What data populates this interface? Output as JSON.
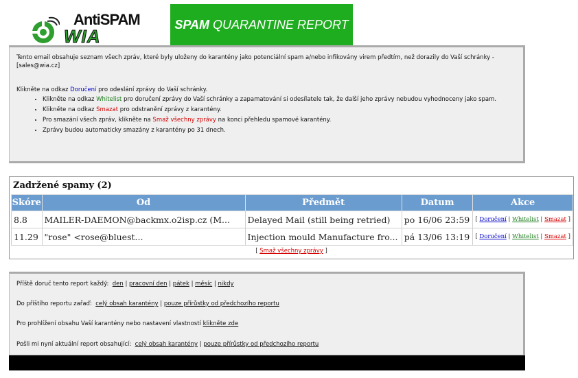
{
  "header": {
    "logo_anti": "AntiSPAM",
    "logo_wia": "WIA",
    "banner_strong": "SPAM",
    "banner_rest": "QUARANTINE REPORT"
  },
  "info": {
    "intro": "Tento email obsahuje seznam všech zpráv, které byly uloženy do karantény jako potenciální spam a/nebo infikovány virem předtím, než dorazily do Vaší schránky - [sales@wia.cz]",
    "click_pre": "Klikněte na odkaz",
    "click_link": "Doručení",
    "click_post": "pro odeslání zprávy do Vaší schránky.",
    "bullets": [
      {
        "pre": "Klikněte na odkaz",
        "link": "Whitelist",
        "post": "pro doručení zprávy do Vaší schránky a zapamatování si odesílatele tak, že další jeho zprávy nebudou vyhodnoceny jako spam."
      },
      {
        "pre": "Klikněte na odkaz",
        "link": "Smazat",
        "post": "pro odstranění zprávy z karantény."
      },
      {
        "pre": "Pro smazání všech zpráv, klikněte na",
        "link": "Smaž všechny zprávy",
        "post": "na konci přehledu spamové karantény."
      },
      {
        "pre": "Zprávy budou automaticky smazány z karantény po 31 dnech.",
        "link": "",
        "post": ""
      }
    ]
  },
  "table": {
    "title": "Zadržené spamy (2)",
    "headers": [
      "Skóre",
      "Od",
      "Předmět",
      "Datum",
      "Akce"
    ],
    "rows": [
      {
        "score": "8.8",
        "from": "MAILER-DAEMON@backmx.o2isp.cz (M...",
        "subject": "Delayed Mail (still being retried)",
        "date": "po 16/06 23:59"
      },
      {
        "score": "11.29",
        "from": "\"rose\" <rose@bluest...",
        "subject": "Injection mould Manufacture fro...",
        "date": "pá 13/06 13:19"
      }
    ],
    "actions": {
      "deliver": "Doručení",
      "whitelist": "Whitelist",
      "delete": "Smazat"
    },
    "delete_all": "Smaž všechny zprávy"
  },
  "bottom": {
    "row1_label": "Příště doruč tento report každý:",
    "row1_links": [
      "den",
      "pracovní den",
      "pátek",
      "měsíc",
      "nikdy"
    ],
    "row2_label": "Do příštího reportu zařaď:",
    "row2_links": [
      "celý obsah karantény",
      "pouze přírůstky od předchozího reportu"
    ],
    "row3_label": "Pro prohlížení obsahu Vaší karantény nebo nastavení vlastností",
    "row3_link": "klikněte zde",
    "row4_label": "Pošli mi nyní aktuální report obsahující:",
    "row4_links": [
      "celý obsah karantény",
      "pouze přírůstky od předchozího reportu"
    ]
  },
  "colors": {
    "brand_green": "#1fad20",
    "table_header": "#6b9ccf",
    "link_blue": "#0000c8",
    "link_red": "#d40000",
    "link_green": "#1a7a1a"
  }
}
